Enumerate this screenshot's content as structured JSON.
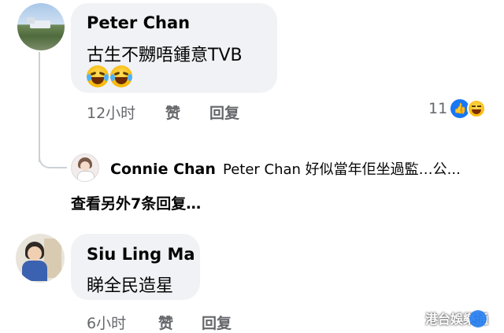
{
  "comments": [
    {
      "author": "Peter Chan",
      "text": "古生不嬲唔鍾意TVB",
      "emoji": [
        "rolling-laughing-emoji",
        "rolling-laughing-emoji"
      ],
      "time": "12小时",
      "like_label": "赞",
      "reply_label": "回复",
      "reaction_count": "11",
      "reactions": [
        "like-icon",
        "haha-icon"
      ],
      "reply_preview": {
        "author": "Connie Chan",
        "text": "Peter Chan 好似當年佢坐過監…公..."
      },
      "more_replies_label": "查看另外7条回复…"
    },
    {
      "author": "Siu Ling Ma",
      "text": "睇全民造星",
      "time": "6小时",
      "like_label": "赞",
      "reply_label": "回复"
    }
  ],
  "watermark": "港台娛樂通",
  "colors": {
    "bubble": "#f0f2f5",
    "meta": "#65676b",
    "like_blue": "#1877f2"
  }
}
